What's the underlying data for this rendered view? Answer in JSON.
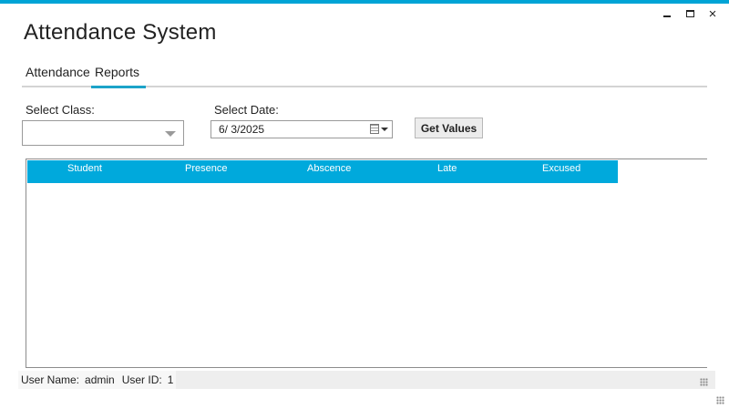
{
  "window": {
    "title": "Attendance System",
    "accent_color": "#00a4d6",
    "controls": {
      "minimize": "minimize-icon",
      "maximize": "maximize-icon",
      "close": "×"
    }
  },
  "tabs": [
    {
      "label": "Attendance",
      "active": false
    },
    {
      "label": "Reports",
      "active": true
    }
  ],
  "filters": {
    "class_label": "Select Class:",
    "class_value": "",
    "date_label": "Select Date:",
    "date_value": "6/  3/2025",
    "get_values_label": "Get Values"
  },
  "grid": {
    "header_color": "#00a9dc",
    "columns": [
      "Student",
      "Presence",
      "Abscence",
      "Late",
      "Excused"
    ],
    "rows": []
  },
  "status": {
    "user_name_label": "User Name:",
    "user_name_value": "admin",
    "user_id_label": "User ID:",
    "user_id_value": "1"
  }
}
